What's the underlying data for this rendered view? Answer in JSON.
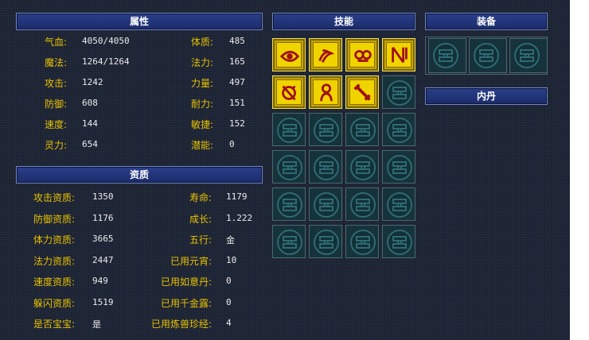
{
  "attributes": {
    "header": "属性",
    "left": [
      {
        "label": "气血:",
        "value": "4050/4050"
      },
      {
        "label": "魔法:",
        "value": "1264/1264"
      },
      {
        "label": "攻击:",
        "value": "1242"
      },
      {
        "label": "防御:",
        "value": "608"
      },
      {
        "label": "速度:",
        "value": "144"
      },
      {
        "label": "灵力:",
        "value": "654"
      }
    ],
    "right": [
      {
        "label": "体质:",
        "value": "485"
      },
      {
        "label": "法力:",
        "value": "165"
      },
      {
        "label": "力量:",
        "value": "497"
      },
      {
        "label": "耐力:",
        "value": "151"
      },
      {
        "label": "敏捷:",
        "value": "152"
      },
      {
        "label": "潜能:",
        "value": "0"
      }
    ]
  },
  "aptitude": {
    "header": "资质",
    "left": [
      {
        "label": "攻击资质:",
        "value": "1350"
      },
      {
        "label": "防御资质:",
        "value": "1176"
      },
      {
        "label": "体力资质:",
        "value": "3665"
      },
      {
        "label": "法力资质:",
        "value": "2447"
      },
      {
        "label": "速度资质:",
        "value": "949"
      },
      {
        "label": "躲闪资质:",
        "value": "1519"
      },
      {
        "label": "是否宝宝:",
        "value": "是"
      }
    ],
    "right": [
      {
        "label": "寿命:",
        "value": "1179"
      },
      {
        "label": "成长:",
        "value": "1.222"
      },
      {
        "label": "五行:",
        "value": "金"
      },
      {
        "label": "已用元宵:",
        "value": "10"
      },
      {
        "label": "已用如意丹:",
        "value": "0"
      },
      {
        "label": "已用千金露:",
        "value": "0"
      },
      {
        "label": "已用炼兽珍经:",
        "value": "4"
      }
    ]
  },
  "skills": {
    "header": "技能",
    "icons": [
      "eye-skill-icon",
      "serpent-skill-icon",
      "owl-skill-icon",
      "shield-skill-icon",
      "spirit-skill-icon",
      "figure-skill-icon",
      "sword-skill-icon"
    ],
    "total_slots": 24
  },
  "equipment": {
    "header": "装备",
    "slots": 3
  },
  "neidan": {
    "header": "内丹"
  },
  "colors": {
    "label": "#e8c200",
    "value": "#ececec",
    "header": "#2a3f8a",
    "skill": "#f0d400"
  }
}
